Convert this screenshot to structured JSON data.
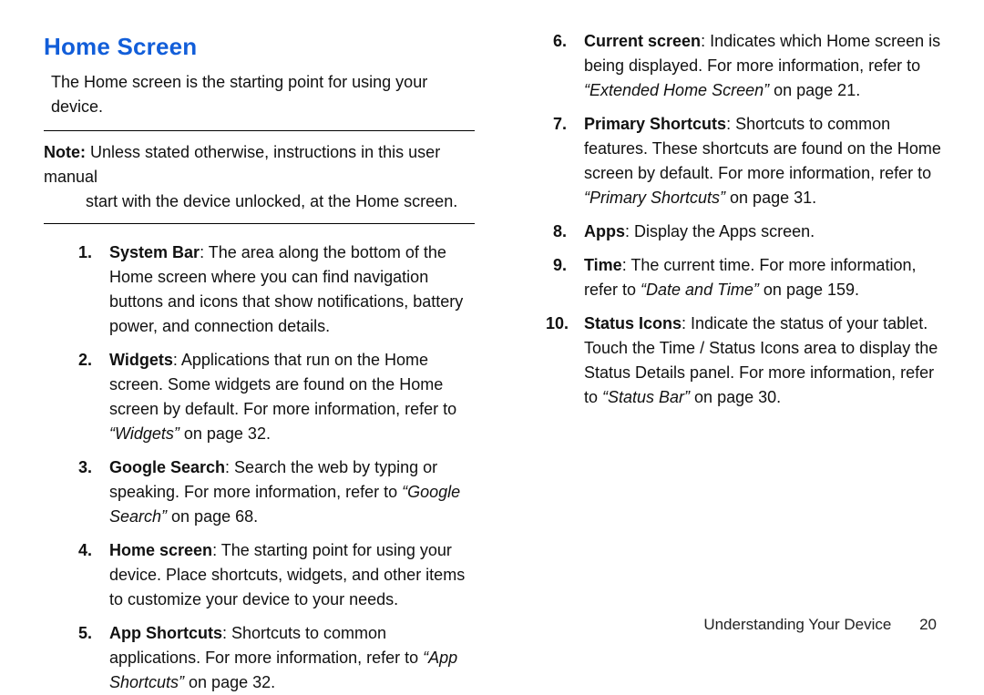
{
  "title": "Home Screen",
  "intro": "The Home screen is the starting point for using your device.",
  "note": {
    "label": "Note:",
    "line1": "Unless stated otherwise, instructions in this user manual",
    "line2": "start with the device unlocked, at the Home screen."
  },
  "items": {
    "i1": {
      "num": "1.",
      "term": "System Bar",
      "text": ": The area along the bottom of the Home screen where you can find navigation buttons and icons that show notifications, battery power, and connection details."
    },
    "i2": {
      "num": "2.",
      "term": "Widgets",
      "text_a": ": Applications that run on the Home screen. Some widgets are found on the Home screen by default. For more information, refer to ",
      "ref": "“Widgets”",
      "text_b": " on page 32."
    },
    "i3": {
      "num": "3.",
      "term": "Google Search",
      "text_a": ": Search the web by typing or speaking. For more information, refer to ",
      "ref": "“Google Search”",
      "text_b": " on page 68."
    },
    "i4": {
      "num": "4.",
      "term": "Home screen",
      "text": ": The starting point for using your device. Place shortcuts, widgets, and other items to customize your device to your needs."
    },
    "i5": {
      "num": "5.",
      "term": "App Shortcuts",
      "text_a": ": Shortcuts to common applications. For more information, refer to ",
      "ref": "“App Shortcuts”",
      "text_b": " on page 32."
    },
    "i6": {
      "num": "6.",
      "term": "Current screen",
      "text_a": ": Indicates which Home screen is being displayed. For more information, refer to ",
      "ref": "“Extended Home Screen”",
      "text_b": " on page 21."
    },
    "i7": {
      "num": "7.",
      "term": "Primary Shortcuts",
      "text_a": ": Shortcuts to common features. These shortcuts are found on the Home screen by default. For more information, refer to ",
      "ref": "“Primary Shortcuts”",
      "text_b": " on page 31."
    },
    "i8": {
      "num": "8.",
      "term": "Apps",
      "text": ": Display the Apps screen."
    },
    "i9": {
      "num": "9.",
      "term": "Time",
      "text_a": ": The current time. For more information, refer to ",
      "ref": "“Date and Time”",
      "text_b": " on page 159."
    },
    "i10": {
      "num": "10.",
      "term": "Status Icons",
      "text_a": ": Indicate the status of your tablet. Touch the Time / Status Icons area to display the Status Details panel. For more information, refer to ",
      "ref": "“Status Bar”",
      "text_b": " on page 30."
    }
  },
  "footer": {
    "section": "Understanding Your Device",
    "page": "20"
  }
}
